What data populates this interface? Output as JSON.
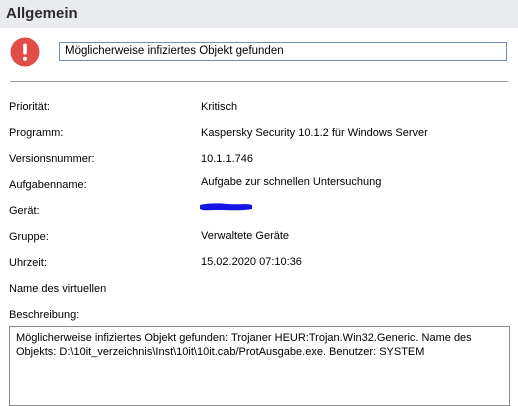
{
  "header": {
    "title": "Allgemein"
  },
  "alert": {
    "icon": "exclamation-circle-icon",
    "color": "#e14c47",
    "title": "Möglicherweise infiziertes Objekt gefunden"
  },
  "details": [
    {
      "label": "Priorität:",
      "value": "Kritisch"
    },
    {
      "label": "Programm:",
      "value": "Kaspersky Security 10.1.2 für Windows Server"
    },
    {
      "label": "Versionsnummer:",
      "value": "10.1.1.746"
    },
    {
      "label": "Aufgabenname:",
      "value": "Aufgabe zur schnellen Untersuchung"
    },
    {
      "label": "Gerät:",
      "value": ""
    },
    {
      "label": "Gruppe:",
      "value": "Verwaltete Geräte"
    },
    {
      "label": "Uhrzeit:",
      "value": "15.02.2020 07:10:36"
    },
    {
      "label": "Name des virtuellen",
      "value": ""
    }
  ],
  "description": {
    "label": "Beschreibung:",
    "text": "Möglicherweise infiziertes Objekt gefunden: Trojaner HEUR:Trojan.Win32.Generic. Name des Objekts: D:\\10it_verzeichnis\\Inst\\10it\\10it.cab/ProtAusgabe.exe. Benutzer: SYSTEM"
  },
  "redaction_color": "#1515e6"
}
